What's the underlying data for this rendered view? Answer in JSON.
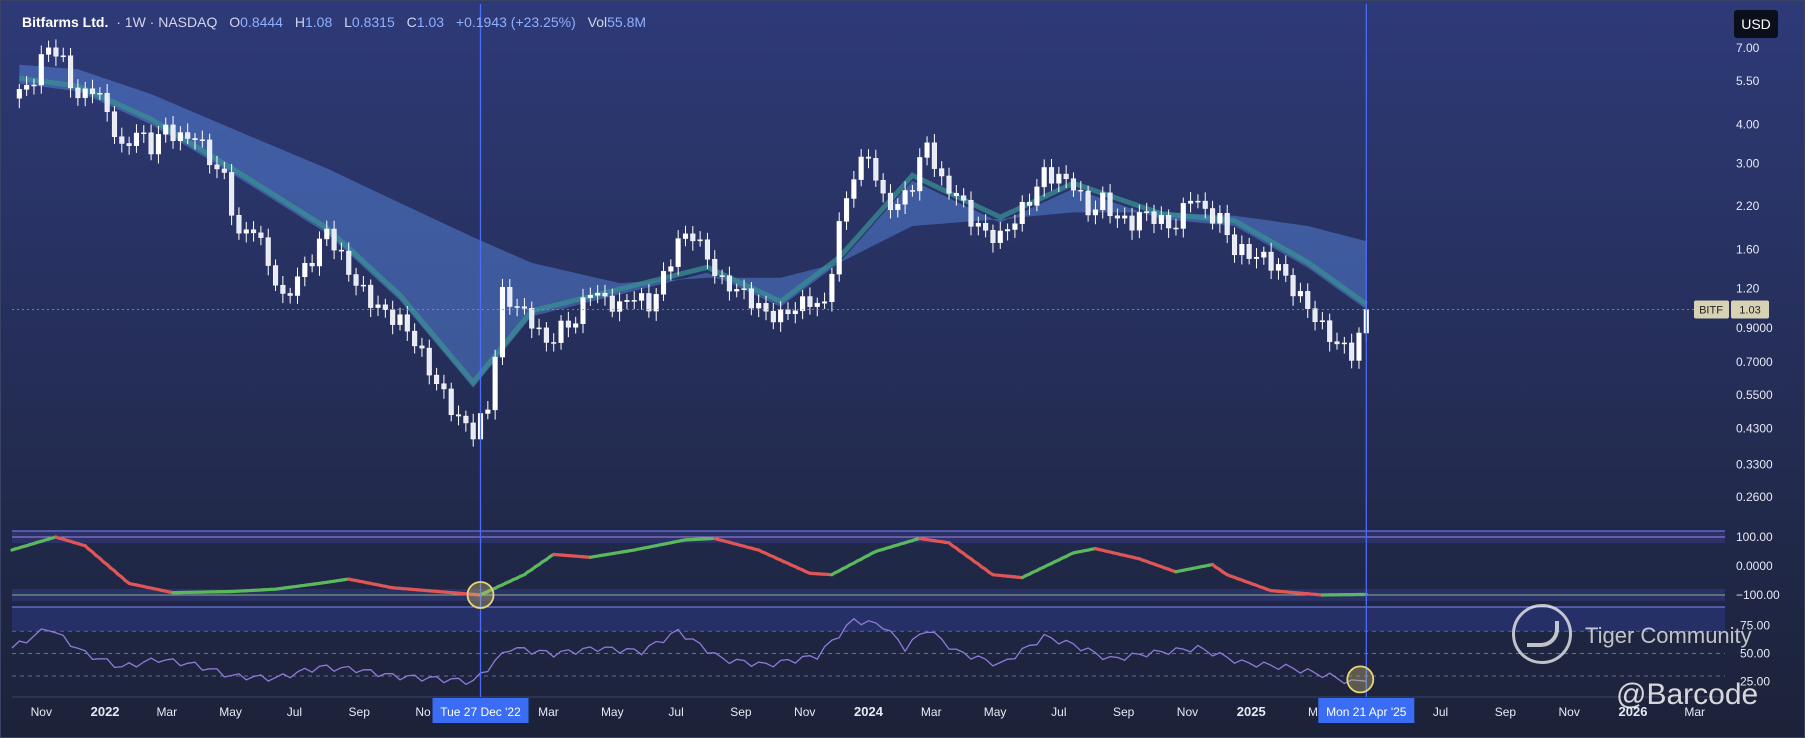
{
  "header": {
    "name": "Bitfarms Ltd.",
    "sep1": "· 1W · NASDAQ",
    "o_label": "O",
    "o_value": "0.8444",
    "h_label": "H",
    "h_value": "1.08",
    "l_label": "L",
    "l_value": "0.8315",
    "c_label": "C",
    "c_value": "1.03",
    "change": "+0.1943 (+23.25%)",
    "vol_label": "Vol",
    "vol_value": "55.8M"
  },
  "currency_button": "USD",
  "price_tag": {
    "symbol": "BITF",
    "value": "1.03"
  },
  "crosshair_labels": [
    "Tue 27 Dec '22",
    "Mon 21 Apr '25"
  ],
  "watermark": {
    "logo_icon": "tiger-logo-icon",
    "title": "Tiger Community",
    "user": "@Barcode"
  },
  "colors": {
    "background_top": "#2e3a78",
    "background_bottom": "#1c2238",
    "candle": "#ffffff",
    "ribbon_light": "#5b8de8",
    "ribbon_teal": "#3a8f94",
    "osc_up": "#5cb85c",
    "osc_down": "#e05656",
    "rsi": "#8e7ad8",
    "crosshair": "#4a6cf7"
  },
  "chart_data": [
    {
      "type": "candlestick",
      "symbol": "BITF",
      "interval": "1W",
      "scale": "log",
      "ylim": [
        0.22,
        8.0
      ],
      "y_ticks": [
        "7.00",
        "5.50",
        "4.00",
        "3.00",
        "2.20",
        "1.60",
        "1.20",
        "0.9000",
        "0.7000",
        "0.5500",
        "0.4300",
        "0.3300",
        "0.2600"
      ],
      "x_ticks": [
        "Nov",
        "2022",
        "Mar",
        "May",
        "Jul",
        "Sep",
        "No",
        "Mar",
        "May",
        "Jul",
        "Sep",
        "Nov",
        "2024",
        "Mar",
        "May",
        "Jul",
        "Sep",
        "Nov",
        "2025",
        "M",
        "Jul",
        "Sep",
        "Nov",
        "2026",
        "Mar"
      ],
      "x_range": [
        "2021-10-04",
        "2026-03-30"
      ],
      "close_anchors": [
        [
          "2021-10-11",
          5.0
        ],
        [
          "2021-10-25",
          5.6
        ],
        [
          "2021-11-08",
          7.2
        ],
        [
          "2021-11-22",
          6.3
        ],
        [
          "2021-12-06",
          4.8
        ],
        [
          "2021-12-20",
          5.3
        ],
        [
          "2022-01-03",
          4.4
        ],
        [
          "2022-01-17",
          3.3
        ],
        [
          "2022-01-31",
          3.8
        ],
        [
          "2022-02-14",
          3.4
        ],
        [
          "2022-02-28",
          3.9
        ],
        [
          "2022-03-14",
          3.6
        ],
        [
          "2022-03-28",
          3.7
        ],
        [
          "2022-04-11",
          3.1
        ],
        [
          "2022-04-25",
          2.7
        ],
        [
          "2022-05-09",
          1.75
        ],
        [
          "2022-05-23",
          1.9
        ],
        [
          "2022-06-06",
          1.45
        ],
        [
          "2022-06-20",
          1.1
        ],
        [
          "2022-07-04",
          1.3
        ],
        [
          "2022-07-18",
          1.5
        ],
        [
          "2022-08-01",
          1.85
        ],
        [
          "2022-08-15",
          1.5
        ],
        [
          "2022-08-29",
          1.25
        ],
        [
          "2022-09-12",
          1.1
        ],
        [
          "2022-09-26",
          1.0
        ],
        [
          "2022-10-10",
          0.95
        ],
        [
          "2022-10-24",
          0.82
        ],
        [
          "2022-11-07",
          0.66
        ],
        [
          "2022-11-21",
          0.55
        ],
        [
          "2022-12-05",
          0.46
        ],
        [
          "2022-12-19",
          0.42
        ],
        [
          "2023-01-02",
          0.5
        ],
        [
          "2023-01-09",
          0.75
        ],
        [
          "2023-01-16",
          1.15
        ],
        [
          "2023-01-30",
          1.05
        ],
        [
          "2023-02-13",
          0.95
        ],
        [
          "2023-02-27",
          0.8
        ],
        [
          "2023-03-13",
          0.9
        ],
        [
          "2023-03-27",
          0.95
        ],
        [
          "2023-04-10",
          1.2
        ],
        [
          "2023-04-24",
          1.1
        ],
        [
          "2023-05-08",
          1.05
        ],
        [
          "2023-05-22",
          1.15
        ],
        [
          "2023-06-05",
          1.05
        ],
        [
          "2023-06-19",
          1.3
        ],
        [
          "2023-07-03",
          1.7
        ],
        [
          "2023-07-17",
          1.8
        ],
        [
          "2023-07-31",
          1.5
        ],
        [
          "2023-08-14",
          1.25
        ],
        [
          "2023-08-28",
          1.2
        ],
        [
          "2023-09-11",
          1.1
        ],
        [
          "2023-09-25",
          1.0
        ],
        [
          "2023-10-09",
          0.98
        ],
        [
          "2023-10-23",
          1.05
        ],
        [
          "2023-11-06",
          1.1
        ],
        [
          "2023-11-20",
          1.05
        ],
        [
          "2023-12-04",
          1.9
        ],
        [
          "2023-12-18",
          2.8
        ],
        [
          "2024-01-01",
          3.2
        ],
        [
          "2024-01-15",
          2.3
        ],
        [
          "2024-01-29",
          2.2
        ],
        [
          "2024-02-12",
          2.6
        ],
        [
          "2024-02-26",
          3.5
        ],
        [
          "2024-03-11",
          2.6
        ],
        [
          "2024-03-25",
          2.4
        ],
        [
          "2024-04-08",
          2.0
        ],
        [
          "2024-04-22",
          1.8
        ],
        [
          "2024-05-06",
          1.75
        ],
        [
          "2024-05-20",
          2.0
        ],
        [
          "2024-06-03",
          2.3
        ],
        [
          "2024-06-17",
          2.8
        ],
        [
          "2024-07-01",
          2.7
        ],
        [
          "2024-07-15",
          2.6
        ],
        [
          "2024-07-29",
          2.1
        ],
        [
          "2024-08-12",
          2.3
        ],
        [
          "2024-08-26",
          2.0
        ],
        [
          "2024-09-09",
          1.95
        ],
        [
          "2024-09-23",
          2.1
        ],
        [
          "2024-10-07",
          1.95
        ],
        [
          "2024-10-21",
          1.9
        ],
        [
          "2024-11-04",
          2.4
        ],
        [
          "2024-11-18",
          2.1
        ],
        [
          "2024-12-02",
          2.0
        ],
        [
          "2024-12-16",
          1.6
        ],
        [
          "2024-12-30",
          1.55
        ],
        [
          "2025-01-13",
          1.5
        ],
        [
          "2025-01-27",
          1.4
        ],
        [
          "2025-02-10",
          1.2
        ],
        [
          "2025-02-24",
          1.05
        ],
        [
          "2025-03-10",
          0.9
        ],
        [
          "2025-03-24",
          0.8
        ],
        [
          "2025-04-07",
          0.75
        ],
        [
          "2025-04-14",
          0.84
        ],
        [
          "2025-04-21",
          1.03
        ]
      ],
      "ema_ribbon": {
        "fast_anchors": [
          [
            "2021-10-11",
            5.4
          ],
          [
            "2021-12-06",
            5.1
          ],
          [
            "2022-02-14",
            4.0
          ],
          [
            "2022-05-09",
            2.7
          ],
          [
            "2022-08-01",
            1.8
          ],
          [
            "2022-10-10",
            1.1
          ],
          [
            "2022-12-19",
            0.58
          ],
          [
            "2023-02-13",
            0.98
          ],
          [
            "2023-05-08",
            1.15
          ],
          [
            "2023-07-31",
            1.35
          ],
          [
            "2023-10-09",
            1.05
          ],
          [
            "2023-12-04",
            1.45
          ],
          [
            "2024-02-12",
            2.65
          ],
          [
            "2024-05-06",
            1.95
          ],
          [
            "2024-07-15",
            2.5
          ],
          [
            "2024-10-07",
            2.0
          ],
          [
            "2024-12-16",
            1.9
          ],
          [
            "2025-02-24",
            1.4
          ],
          [
            "2025-04-21",
            1.03
          ]
        ],
        "slow_anchors": [
          [
            "2021-10-11",
            6.2
          ],
          [
            "2021-12-06",
            6.0
          ],
          [
            "2022-02-14",
            5.0
          ],
          [
            "2022-05-09",
            3.8
          ],
          [
            "2022-08-01",
            2.9
          ],
          [
            "2022-10-10",
            2.25
          ],
          [
            "2022-12-19",
            1.75
          ],
          [
            "2023-02-13",
            1.45
          ],
          [
            "2023-05-08",
            1.25
          ],
          [
            "2023-07-31",
            1.3
          ],
          [
            "2023-10-09",
            1.3
          ],
          [
            "2023-12-04",
            1.45
          ],
          [
            "2024-02-12",
            1.9
          ],
          [
            "2024-05-06",
            2.0
          ],
          [
            "2024-07-15",
            2.1
          ],
          [
            "2024-10-07",
            2.1
          ],
          [
            "2024-12-16",
            2.05
          ],
          [
            "2025-02-24",
            1.9
          ],
          [
            "2025-04-21",
            1.7
          ]
        ]
      }
    },
    {
      "type": "line",
      "name": "",
      "ylim": [
        -100,
        100
      ],
      "y_ticks": [
        "100.00",
        "0.0000",
        "−100.00"
      ],
      "levels": [
        100,
        -100
      ],
      "anchors": [
        [
          "2021-10-04",
          55
        ],
        [
          "2021-11-15",
          100
        ],
        [
          "2021-12-13",
          70
        ],
        [
          "2022-01-24",
          -60
        ],
        [
          "2022-03-07",
          -92
        ],
        [
          "2022-05-02",
          -88
        ],
        [
          "2022-06-13",
          -80
        ],
        [
          "2022-07-25",
          -60
        ],
        [
          "2022-08-22",
          -45
        ],
        [
          "2022-10-03",
          -75
        ],
        [
          "2022-12-26",
          -100
        ],
        [
          "2023-02-06",
          -30
        ],
        [
          "2023-03-06",
          40
        ],
        [
          "2023-04-10",
          30
        ],
        [
          "2023-05-22",
          55
        ],
        [
          "2023-07-10",
          90
        ],
        [
          "2023-08-07",
          95
        ],
        [
          "2023-09-18",
          55
        ],
        [
          "2023-11-06",
          -25
        ],
        [
          "2023-11-27",
          -30
        ],
        [
          "2024-01-08",
          50
        ],
        [
          "2024-02-19",
          95
        ],
        [
          "2024-03-18",
          80
        ],
        [
          "2024-04-29",
          -30
        ],
        [
          "2024-05-27",
          -40
        ],
        [
          "2024-07-15",
          45
        ],
        [
          "2024-08-05",
          60
        ],
        [
          "2024-09-16",
          25
        ],
        [
          "2024-10-21",
          -20
        ],
        [
          "2024-11-25",
          5
        ],
        [
          "2024-12-09",
          -30
        ],
        [
          "2025-01-20",
          -85
        ],
        [
          "2025-03-10",
          -100
        ],
        [
          "2025-04-21",
          -98
        ]
      ]
    },
    {
      "type": "line",
      "name": "",
      "ylim": [
        22,
        80
      ],
      "y_ticks": [
        "75.00",
        "50.00",
        "25.00"
      ],
      "anchors": [
        [
          "2021-10-04",
          55
        ],
        [
          "2021-11-08",
          73
        ],
        [
          "2021-12-13",
          50
        ],
        [
          "2022-01-17",
          38
        ],
        [
          "2022-02-21",
          45
        ],
        [
          "2022-03-28",
          40
        ],
        [
          "2022-05-02",
          30
        ],
        [
          "2022-06-13",
          28
        ],
        [
          "2022-07-25",
          38
        ],
        [
          "2022-08-29",
          36
        ],
        [
          "2022-10-03",
          30
        ],
        [
          "2022-11-07",
          28
        ],
        [
          "2022-12-19",
          25
        ],
        [
          "2023-01-23",
          55
        ],
        [
          "2023-03-06",
          50
        ],
        [
          "2023-04-17",
          55
        ],
        [
          "2023-05-29",
          52
        ],
        [
          "2023-07-03",
          70
        ],
        [
          "2023-08-14",
          45
        ],
        [
          "2023-09-25",
          40
        ],
        [
          "2023-11-13",
          48
        ],
        [
          "2023-12-18",
          80
        ],
        [
          "2024-01-15",
          75
        ],
        [
          "2024-02-05",
          55
        ],
        [
          "2024-02-26",
          72
        ],
        [
          "2024-03-25",
          52
        ],
        [
          "2024-05-06",
          40
        ],
        [
          "2024-06-17",
          65
        ],
        [
          "2024-07-15",
          58
        ],
        [
          "2024-08-19",
          45
        ],
        [
          "2024-09-23",
          50
        ],
        [
          "2024-11-11",
          55
        ],
        [
          "2024-12-23",
          42
        ],
        [
          "2025-02-03",
          38
        ],
        [
          "2025-03-17",
          30
        ],
        [
          "2025-04-07",
          24
        ],
        [
          "2025-04-21",
          28
        ]
      ]
    }
  ]
}
